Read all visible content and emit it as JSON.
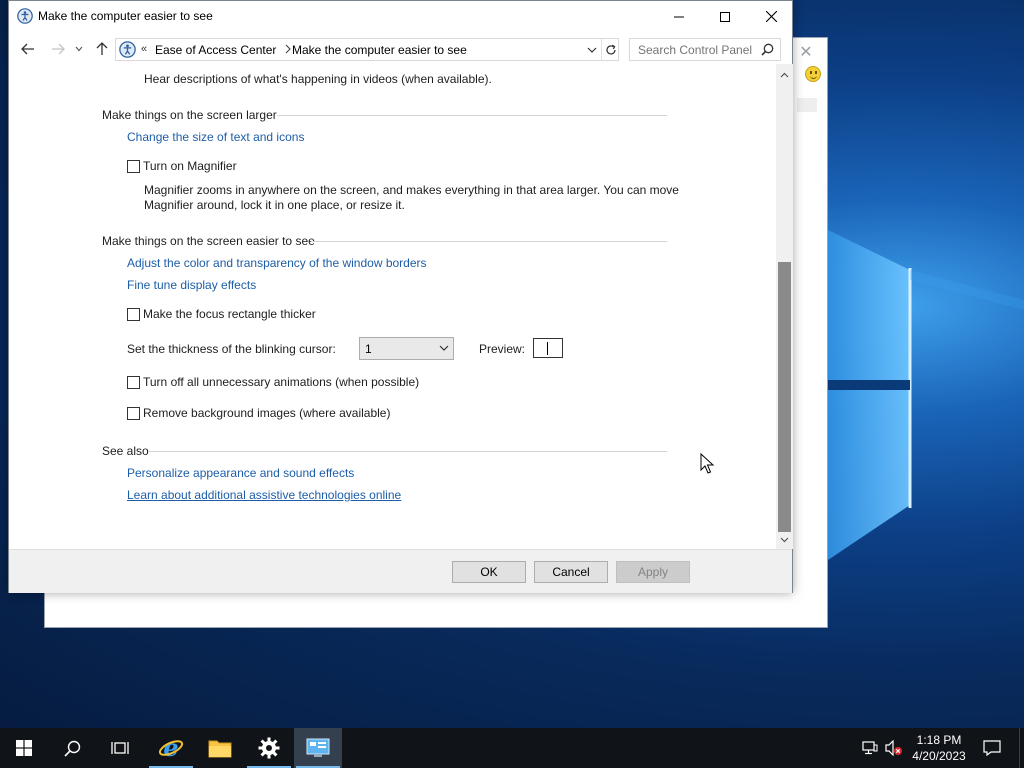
{
  "window": {
    "title": "Make the computer easier to see"
  },
  "address_bar": {
    "chevrons": "«",
    "crumbs": [
      "Ease of Access Center",
      "Make the computer easier to see"
    ]
  },
  "search": {
    "placeholder": "Search Control Panel"
  },
  "content": {
    "top_description": "Hear descriptions of what's happening in videos (when available).",
    "section_larger": {
      "title": "Make things on the screen larger",
      "link_text_size": "Change the size of text and icons",
      "magnifier_label": "Turn on Magnifier",
      "magnifier_checked": false,
      "magnifier_desc_line1": "Magnifier zooms in anywhere on the screen, and makes everything in that area larger. You can move",
      "magnifier_desc_line2": "Magnifier around, lock it in one place, or resize it."
    },
    "section_easier": {
      "title": "Make things on the screen easier to see",
      "link_color": "Adjust the color and transparency of the window borders",
      "link_display": "Fine tune display effects",
      "focus_label": "Make the focus rectangle thicker",
      "focus_checked": false,
      "cursor_label": "Set the thickness of the blinking cursor:",
      "cursor_value": "1",
      "preview_label": "Preview:",
      "animations_label": "Turn off all unnecessary animations (when possible)",
      "animations_checked": false,
      "background_label": "Remove background images (where available)",
      "background_checked": false
    },
    "section_see_also": {
      "title": "See also",
      "link_personalize": "Personalize appearance and sound effects",
      "link_learn": "Learn about additional assistive technologies online"
    }
  },
  "buttons": {
    "ok": "OK",
    "cancel": "Cancel",
    "apply": "Apply"
  },
  "taskbar": {
    "time": "1:18 PM",
    "date": "4/20/2023"
  },
  "colors": {
    "link": "#1d5ea8",
    "taskbar": "#101418",
    "active_task": "#34404d",
    "accent": "#76b9ed"
  }
}
